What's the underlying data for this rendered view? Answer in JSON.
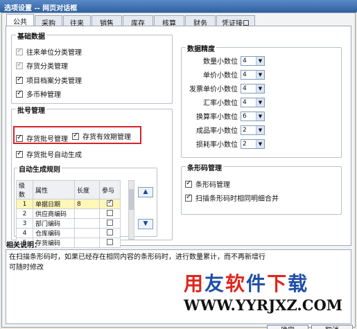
{
  "window": {
    "title": "选项设置 -- 网页对话框"
  },
  "tabs": [
    {
      "label": "公共",
      "active": true
    },
    {
      "label": "采购",
      "active": false
    },
    {
      "label": "往来",
      "active": false
    },
    {
      "label": "销售",
      "active": false
    },
    {
      "label": "库存",
      "active": false
    },
    {
      "label": "核算",
      "active": false
    },
    {
      "label": "财务",
      "active": false
    },
    {
      "label": "凭证接口",
      "active": false
    }
  ],
  "basic_data": {
    "title": "基础数据",
    "items": [
      {
        "label": "往来单位分类管理",
        "checked": true,
        "disabled": true
      },
      {
        "label": "存货分类管理",
        "checked": true,
        "disabled": true
      },
      {
        "label": "项目档案分类管理",
        "checked": true,
        "disabled": false
      },
      {
        "label": "多币种管理",
        "checked": true,
        "disabled": false
      }
    ]
  },
  "batch_mgmt": {
    "title": "批号管理",
    "items": [
      {
        "label": "存货批号管理",
        "checked": true
      },
      {
        "label": "存货有效期管理",
        "checked": true
      },
      {
        "label": "存货批号自动生成",
        "checked": true
      }
    ]
  },
  "auto_rule": {
    "title": "自动生成规则",
    "columns": [
      "级数",
      "属性",
      "长度",
      "参与"
    ],
    "rows": [
      {
        "level": "1",
        "attr": "单据日期",
        "length": "8",
        "join": true
      },
      {
        "level": "2",
        "attr": "供应商编码",
        "length": "",
        "join": false
      },
      {
        "level": "3",
        "attr": "部门编码",
        "length": "",
        "join": false
      },
      {
        "level": "4",
        "attr": "仓库编码",
        "length": "",
        "join": false
      },
      {
        "level": "5",
        "attr": "存货编码",
        "length": "",
        "join": false
      }
    ],
    "up_label": "▲",
    "down_label": "▼"
  },
  "precision": {
    "title": "数据精度",
    "items": [
      {
        "label": "数量小数位",
        "value": "4"
      },
      {
        "label": "单价小数位",
        "value": "4"
      },
      {
        "label": "发票单价小数位",
        "value": "4"
      },
      {
        "label": "汇率小数位",
        "value": "4"
      },
      {
        "label": "换算率小数位",
        "value": "6"
      },
      {
        "label": "成品率小数位",
        "value": "2"
      },
      {
        "label": "损耗率小数位",
        "value": "2"
      }
    ]
  },
  "barcode": {
    "title": "条形码管理",
    "items": [
      {
        "label": "条形码管理",
        "checked": true
      },
      {
        "label": "扫描条形码时相同明细合并",
        "checked": true
      }
    ]
  },
  "description": {
    "title": "相关说明：",
    "lines": [
      "在扫描条形码时，如果已经存在相同内容的条形码时，进行数量累计，而不再新增行",
      "可随时修改"
    ]
  },
  "watermark": {
    "chars": [
      "用",
      "友",
      "软",
      "件",
      "下",
      "载"
    ],
    "url": "WWW.YYRJXZ.COM"
  },
  "buttons": {
    "ok": "确定",
    "cancel": "取消"
  },
  "colors": {
    "highlight_red": "#d8232a",
    "wm_red": "#e0261c",
    "wm_blue": "#1f4fa8",
    "selected_row": "#fff6b8"
  }
}
